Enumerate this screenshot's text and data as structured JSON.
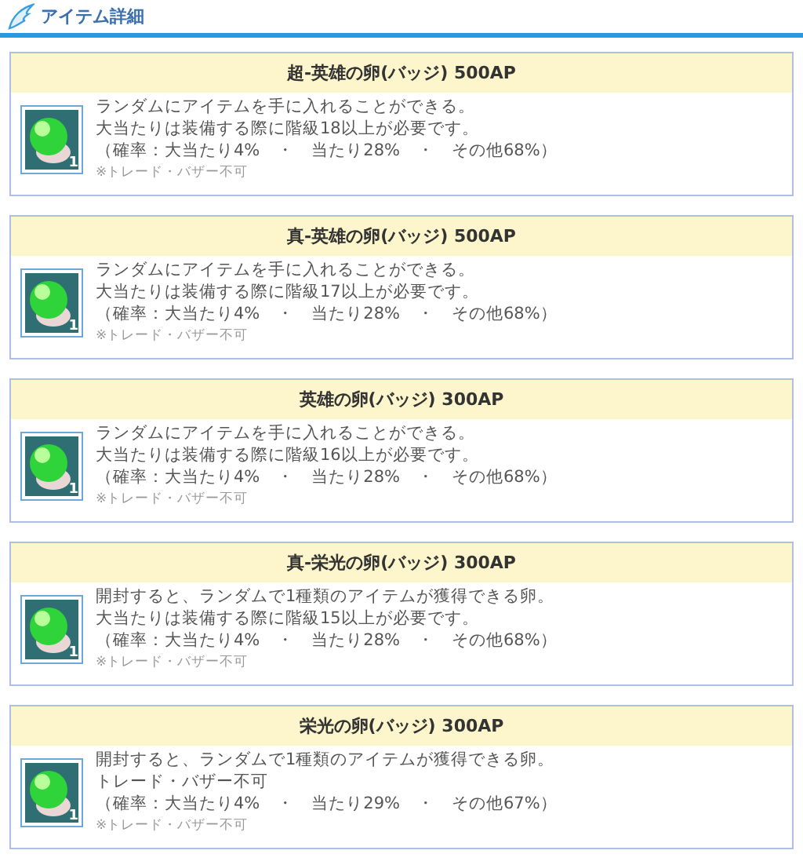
{
  "header": {
    "title": "アイテム詳細"
  },
  "items": [
    {
      "name": "超-英雄の卵(バッジ) 500AP",
      "count": "1",
      "lines": [
        "ランダムにアイテムを手に入れることができる。",
        "大当たりは装備する際に階級18以上が必要です。",
        "（確率：大当たり4%　・　当たり28%　・　その他68%）"
      ],
      "note": "※トレード・バザー不可"
    },
    {
      "name": "真-英雄の卵(バッジ) 500AP",
      "count": "1",
      "lines": [
        "ランダムにアイテムを手に入れることができる。",
        "大当たりは装備する際に階級17以上が必要です。",
        "（確率：大当たり4%　・　当たり28%　・　その他68%）"
      ],
      "note": "※トレード・バザー不可"
    },
    {
      "name": "英雄の卵(バッジ) 300AP",
      "count": "1",
      "lines": [
        "ランダムにアイテムを手に入れることができる。",
        "大当たりは装備する際に階級16以上が必要です。",
        "（確率：大当たり4%　・　当たり28%　・　その他68%）"
      ],
      "note": "※トレード・バザー不可"
    },
    {
      "name": "真-栄光の卵(バッジ) 300AP",
      "count": "1",
      "lines": [
        "開封すると、ランダムで1種類のアイテムが獲得できる卵。",
        "大当たりは装備する際に階級15以上が必要です。",
        "（確率：大当たり4%　・　当たり28%　・　その他68%）"
      ],
      "note": "※トレード・バザー不可"
    },
    {
      "name": "栄光の卵(バッジ) 300AP",
      "count": "1",
      "lines": [
        "開封すると、ランダムで1種類のアイテムが獲得できる卵。",
        "トレード・バザー不可",
        "（確率：大当たり4%　・　当たり29%　・　その他67%）"
      ],
      "note": "※トレード・バザー不可"
    }
  ]
}
